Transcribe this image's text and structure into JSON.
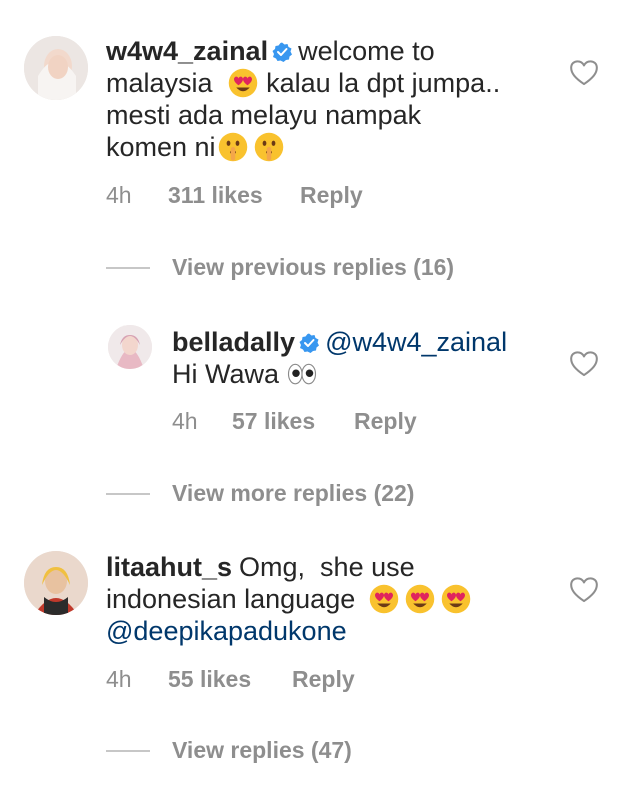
{
  "comments": [
    {
      "username": "w4w4_zainal",
      "verified": true,
      "lines": [
        "welcome to",
        "malaysia",
        "kalau la dpt jumpa..",
        "mesti ada melayu nampak",
        "komen ni"
      ],
      "time": "4h",
      "likes": "311 likes",
      "reply": "Reply",
      "view_replies": "View previous replies (16)"
    },
    {
      "username": "belladally",
      "verified": true,
      "mention": "@w4w4_zainal",
      "lines": [
        "Hi Wawa"
      ],
      "time": "4h",
      "likes": "57 likes",
      "reply": "Reply",
      "view_replies": "View more replies (22)"
    },
    {
      "username": "litaahut_s",
      "verified": false,
      "lines": [
        "Omg,  she use",
        "indonesian language"
      ],
      "mention": "@deepikapadukone",
      "time": "4h",
      "likes": "55 likes",
      "reply": "Reply",
      "view_replies": "View replies (47)"
    }
  ],
  "icons": {
    "like": "heart-outline-icon",
    "verified": "verified-badge-icon",
    "emoji_heart_eyes": "heart-eyes-emoji-icon",
    "emoji_shush": "shushing-face-emoji-icon",
    "emoji_eyes": "eyes-emoji-icon"
  },
  "colors": {
    "text": "#262626",
    "secondary": "#8e8e8e",
    "mention": "#00376b",
    "verified": "#3897f0",
    "divider": "#c7c7c7"
  }
}
